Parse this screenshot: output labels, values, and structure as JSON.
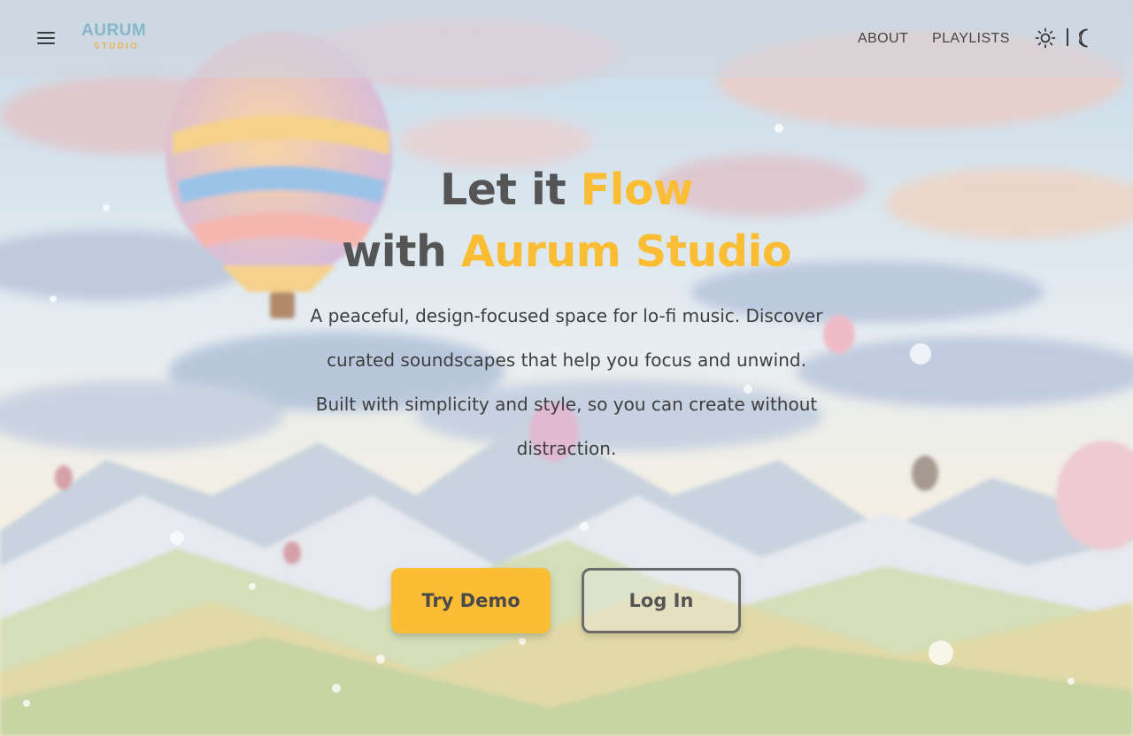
{
  "header": {
    "logo_top": "AURUM",
    "logo_bottom": "STUDIO",
    "menu_icon": "hamburger-menu-icon",
    "nav": [
      {
        "label": "ABOUT"
      },
      {
        "label": "PLAYLISTS"
      }
    ],
    "theme_toggle": {
      "light_icon": "sun-icon",
      "dark_icon": "moon-icon"
    }
  },
  "hero": {
    "title_line1_plain": "Let it ",
    "title_line1_accent": "Flow",
    "title_line2_plain": "with ",
    "title_line2_accent": "Aurum Studio",
    "paragraph_1": "A peaceful, design-focused space for lo-fi music. Discover curated soundscapes that help you focus and unwind.",
    "paragraph_2": "Built with simplicity and style, so you can create without distraction.",
    "primary_button": "Try Demo",
    "secondary_button": "Log In"
  },
  "colors": {
    "accent": "#fbbd34",
    "text": "#555555"
  }
}
